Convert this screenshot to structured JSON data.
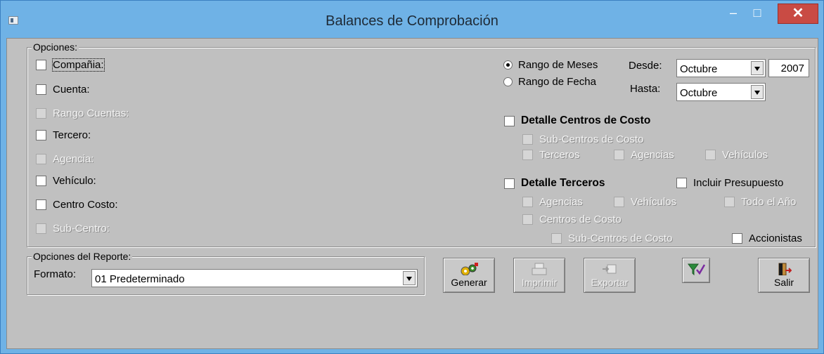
{
  "window": {
    "title": "Balances de Comprobación",
    "close_glyph": "✕",
    "minimize_glyph": "–",
    "maximize_glyph": "□"
  },
  "opciones": {
    "legend": "Opciones:",
    "items": [
      {
        "label": "Compañia:",
        "enabled": true
      },
      {
        "label": "Cuenta:",
        "enabled": true
      },
      {
        "label": "Rango Cuentas:",
        "enabled": false
      },
      {
        "label": "Tercero:",
        "enabled": true
      },
      {
        "label": "Agencia:",
        "enabled": false
      },
      {
        "label": "Vehículo:",
        "enabled": true
      },
      {
        "label": "Centro Costo:",
        "enabled": true
      },
      {
        "label": "Sub-Centro:",
        "enabled": false
      }
    ],
    "rango_meses": "Rango de Meses",
    "rango_fecha": "Rango de Fecha",
    "desde_label": "Desde:",
    "hasta_label": "Hasta:",
    "desde_mes": "Octubre",
    "desde_anio": "2007",
    "hasta_mes": "Octubre",
    "detalle_cc": "Detalle Centros de Costo",
    "sub_cc": "Sub-Centros de Costo",
    "cc_terceros": "Terceros",
    "cc_agencias": "Agencias",
    "cc_vehiculos": "Vehículos",
    "detalle_terceros": "Detalle Terceros",
    "incluir_presupuesto": "Incluir Presupuesto",
    "t_agencias": "Agencias",
    "t_vehiculos": "Vehículos",
    "t_todo_anio": "Todo el Año",
    "t_centros_costo": "Centros de Costo",
    "t_sub_cc": "Sub-Centros de Costo",
    "accionistas": "Accionistas"
  },
  "reporte": {
    "legend": "Opciones del Reporte:",
    "formato_label": "Formato:",
    "formato_value": "01 Predeterminado"
  },
  "buttons": {
    "generar": "Generar",
    "imprimir": "Imprimir",
    "exportar": "Exportar",
    "salir": "Salir"
  },
  "colors": {
    "titlebar": "#6fb2e6",
    "close": "#c94b44",
    "client": "#c0c0c0"
  }
}
